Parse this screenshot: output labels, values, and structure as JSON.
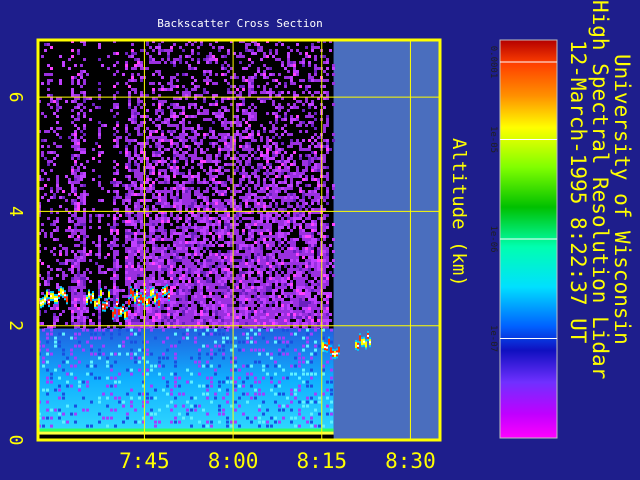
{
  "chart_data": {
    "type": "heatmap",
    "title": "Backscatter Cross Section",
    "ylabel": "Altitude (km)",
    "x_ticks": [
      "7:45",
      "8:00",
      "8:15",
      "8:30"
    ],
    "x_tick_minutes": [
      465,
      480,
      495,
      510
    ],
    "xlim_minutes": [
      447,
      515
    ],
    "y_ticks": [
      0,
      2,
      4,
      6
    ],
    "ylim": [
      0,
      7
    ],
    "data_end_minute": 497,
    "grid": true,
    "colorbar": {
      "ticks": [
        "0.0001",
        "1e-05",
        "1e-06",
        "1e-07"
      ],
      "scale": "log",
      "range": [
        1e-08,
        0.0001
      ]
    },
    "header": {
      "line1": "University of Wisconsin",
      "line2": "High Spectral Resolution Lidar",
      "line3": "12-March-1995   8:22:37 UT"
    }
  },
  "colors": {
    "background": "#1e1e8c",
    "axes_frame": "#ffff00",
    "grid": "#ffff00",
    "no_data": "#4a6ebe",
    "title_text": "#ffffff"
  }
}
